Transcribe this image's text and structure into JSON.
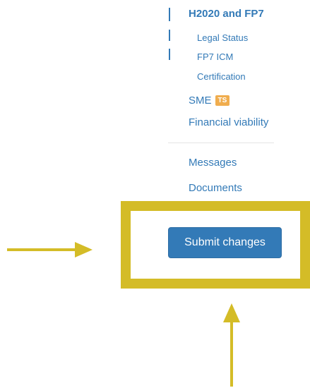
{
  "nav": {
    "section_title": "H2020 and FP7",
    "sub_items": [
      {
        "label": "Legal Status"
      },
      {
        "label": "FP7 ICM"
      },
      {
        "label": "Certification"
      }
    ],
    "sme_label": "SME",
    "sme_badge": "TS",
    "financial_viability": "Financial viability",
    "messages": "Messages",
    "documents": "Documents"
  },
  "actions": {
    "submit_label": "Submit changes"
  },
  "colors": {
    "link": "#337ab7",
    "button_bg": "#337ab7",
    "badge": "#f0ad4e",
    "annotation": "#d4bc27"
  }
}
